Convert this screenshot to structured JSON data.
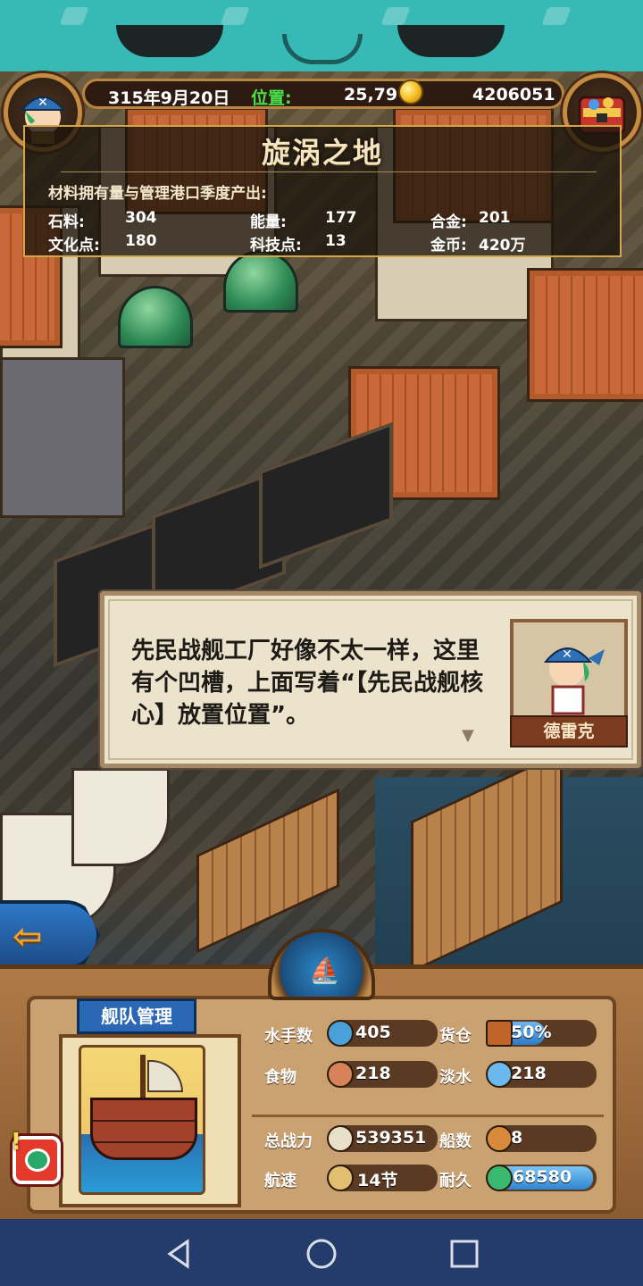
{
  "header": {
    "date": "315年9月20日",
    "position_label": "位置:",
    "position_value": "25,79",
    "gold": "4206051"
  },
  "area": {
    "title": "旋涡之地",
    "caption": "材料拥有量与管理港口季度产出:",
    "stats": [
      {
        "label": "石料:",
        "value": "304"
      },
      {
        "label": "能量:",
        "value": "177"
      },
      {
        "label": "合金:",
        "value": "201"
      },
      {
        "label": "文化点:",
        "value": "180"
      },
      {
        "label": "科技点:",
        "value": "13"
      },
      {
        "label": "金币:",
        "value": "420万"
      }
    ]
  },
  "dialog": {
    "text": "先民战舰工厂好像不太一样，这里有个凹槽，上面写着“【先民战舰核心】放置位置”。",
    "speaker": "德雷克",
    "next_glyph": "▼"
  },
  "back_button": {
    "glyph": "⇦"
  },
  "fleet": {
    "tab_label": "舰队管理",
    "alert_glyph": "!",
    "stats": [
      {
        "label": "水手数",
        "value": "405",
        "icon": "sailor-icon",
        "color": "#4aa0d8"
      },
      {
        "label": "货仓",
        "value": "50%",
        "icon": "cargo-crate-icon",
        "color": "#c0642a",
        "fill": 0.5
      },
      {
        "label": "食物",
        "value": "218",
        "icon": "meat-icon",
        "color": "#d8825a"
      },
      {
        "label": "淡水",
        "value": "218",
        "icon": "water-jug-icon",
        "color": "#6ab8ec"
      },
      {
        "label": "总战力",
        "value": "539351",
        "icon": "crossed-swords-icon",
        "color": "#e8e0c8"
      },
      {
        "label": "船数",
        "value": "8",
        "icon": "boat-icon",
        "color": "#d88a3a"
      },
      {
        "label": "航速",
        "value": "14节",
        "icon": "ship-speed-icon",
        "color": "#e0c070"
      },
      {
        "label": "耐久",
        "value": "68580",
        "icon": "ship-durability-icon",
        "color": "#3ab870",
        "fill": 1.0
      }
    ]
  }
}
